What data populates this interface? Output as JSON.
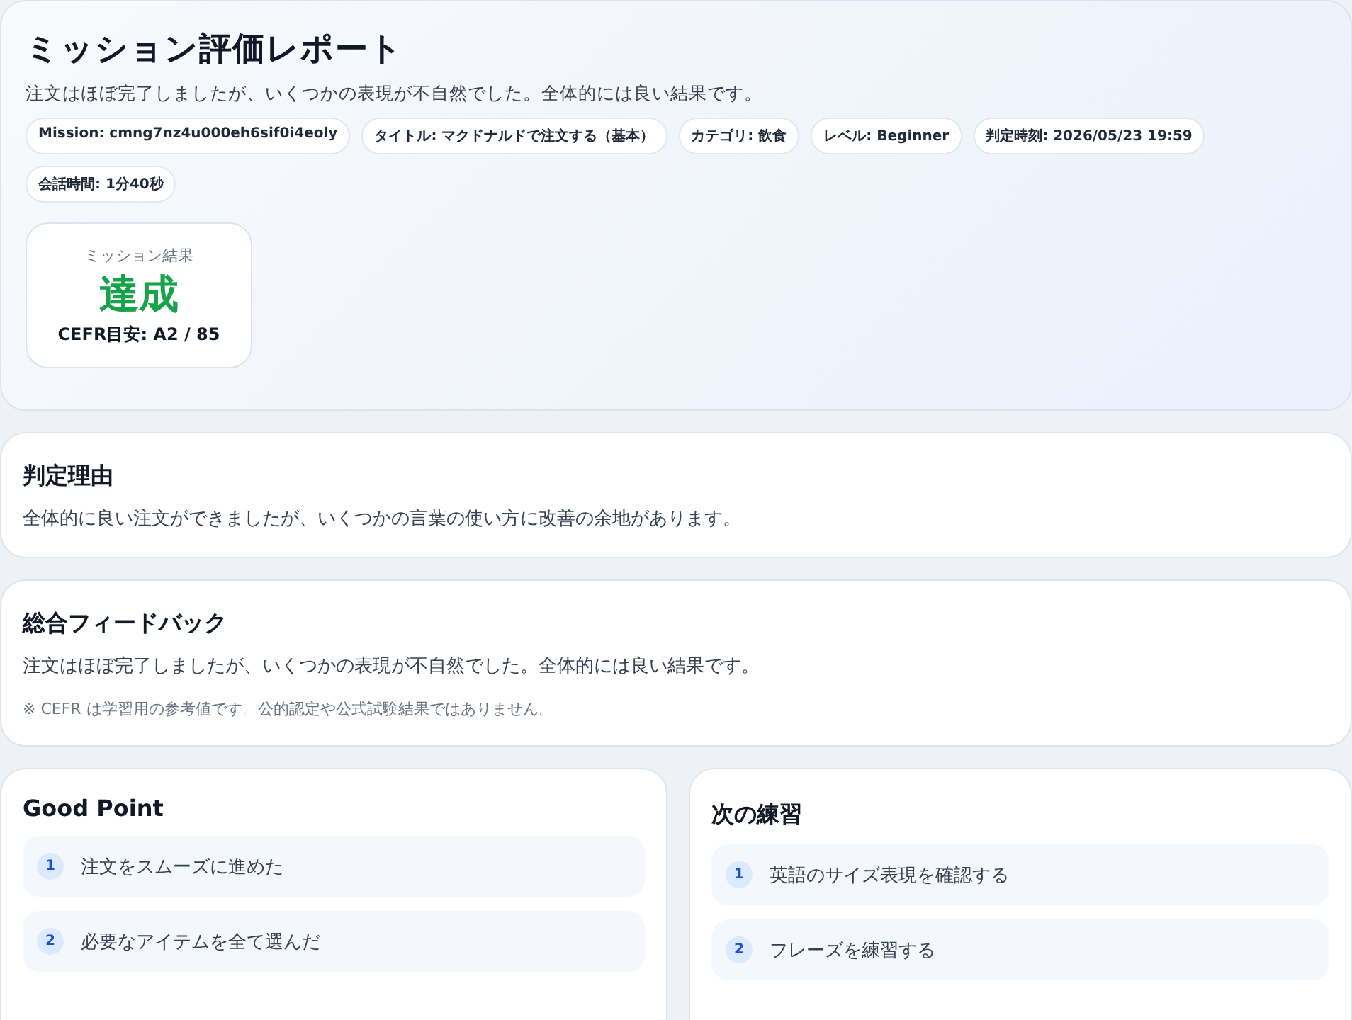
{
  "header": {
    "title": "ミッション評価レポート",
    "summary": "注文はほぼ完了しましたが、いくつかの表現が不自然でした。全体的には良い結果です。",
    "tags": [
      "Mission: cmng7nz4u000eh6sif0i4eoly",
      "タイトル: マクドナルドで注文する（基本）",
      "カテゴリ: 飲食",
      "レベル: Beginner",
      "判定時刻: 2026/05/23 19:59",
      "会話時間: 1分40秒"
    ],
    "result": {
      "label": "ミッション結果",
      "value": "達成",
      "success": true,
      "cefr": "CEFR目安: A2 / 85"
    }
  },
  "reason": {
    "title": "判定理由",
    "text": "全体的に良い注文ができましたが、いくつかの言葉の使い方に改善の余地があります。"
  },
  "feedback": {
    "title": "総合フィードバック",
    "text": "注文はほぼ完了しましたが、いくつかの表現が不自然でした。全体的には良い結果です。",
    "note": "※ CEFR は学習用の参考値です。公的認定や公式試験結果ではありません。"
  },
  "good_points": {
    "title": "Good Point",
    "items": [
      {
        "number": "1",
        "text": "注文をスムーズに進めた"
      },
      {
        "number": "2",
        "text": "必要なアイテムを全て選んだ"
      }
    ]
  },
  "next_practice": {
    "title": "次の練習",
    "items": [
      {
        "number": "1",
        "text": "英語のサイズ表現を確認する"
      },
      {
        "number": "2",
        "text": "フレーズを練習する"
      }
    ]
  }
}
